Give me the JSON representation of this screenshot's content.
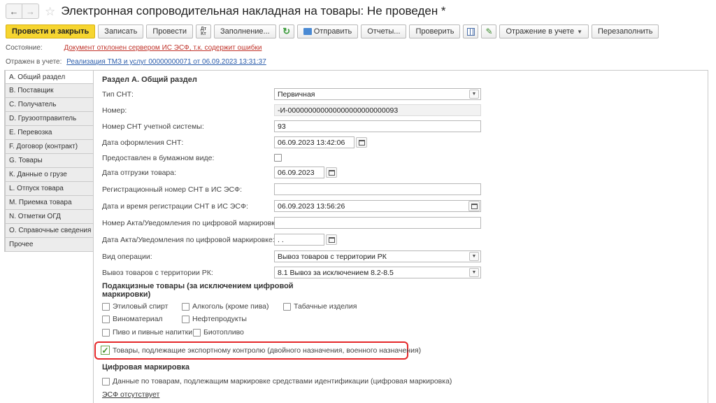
{
  "window": {
    "title": "Электронная сопроводительная накладная на товары: Не проведен *"
  },
  "toolbar": {
    "post_close": "Провести и закрыть",
    "save": "Записать",
    "post": "Провести",
    "fill": "Заполнение...",
    "send": "Отправить",
    "reports": "Отчеты...",
    "check": "Проверить",
    "reflection": "Отражение в учете",
    "refill": "Перезаполнить"
  },
  "status": {
    "state_label": "Состояние:",
    "state_value": "Документ отклонен сервером ИС ЭСФ, т.к. содержит ошибки",
    "reflected_label": "Отражен в учете:",
    "reflected_value": "Реализация ТМЗ и услуг 00000000071 от 06.09.2023 13:31:37"
  },
  "tabs": [
    "А. Общий раздел",
    "В. Поставщик",
    "С. Получатель",
    "D. Грузоотправитель",
    "Е. Перевозка",
    "F. Договор (контракт)",
    "G. Товары",
    "К. Данные о грузе",
    "L. Отпуск товара",
    "М. Приемка товара",
    "N. Отметки ОГД",
    "О. Справочные сведения",
    "Прочее"
  ],
  "form": {
    "section_title": "Раздел А. Общий раздел",
    "snt_type_label": "Тип СНТ:",
    "snt_type_value": "Первичная",
    "number_label": "Номер:",
    "number_value": "-И-000000000000000000000000093",
    "account_number_label": "Номер СНТ учетной системы:",
    "account_number_value": "93",
    "issue_date_label": "Дата оформления СНТ:",
    "issue_date_value": "06.09.2023 13:42:06",
    "paper_label": "Предоставлен в бумажном виде:",
    "ship_date_label": "Дата отгрузки товара:",
    "ship_date_value": "06.09.2023",
    "reg_number_label": "Регистрационный номер СНТ в ИС ЭСФ:",
    "reg_number_value": "",
    "reg_datetime_label": "Дата и время регистрации СНТ в ИС ЭСФ:",
    "reg_datetime_value": "06.09.2023 13:56:26",
    "act_number_label": "Номер Акта/Уведомления по цифровой маркировке:",
    "act_number_value": "",
    "act_date_label": "Дата Акта/Уведомления по цифровой маркировке:",
    "act_date_value": ". .",
    "operation_label": "Вид операции:",
    "operation_value": "Вывоз товаров с территории РК",
    "export_label": "Вывоз товаров с территории РК:",
    "export_value": "8.1 Вывоз за исключением 8.2-8.5"
  },
  "excise": {
    "title": "Подакцизные товары (за исключением цифровой маркировки)",
    "ethyl": "Этиловый спирт",
    "alcohol": "Алкоголь (кроме пива)",
    "tobacco": "Табачные изделия",
    "wine": "Виноматериал",
    "oil": "Нефтепродукты",
    "beer": "Пиво и пивные напитки",
    "biofuel": "Биотопливо",
    "export_control": "Товары, подлежащие экспортному контролю (двойного назначения, военного назначения)"
  },
  "digital": {
    "title": "Цифровая маркировка",
    "marking": "Данные по товарам, подлежащим маркировке средствами идентификации (цифровая маркировка)",
    "esf_link": "ЭСФ отсутствует"
  }
}
